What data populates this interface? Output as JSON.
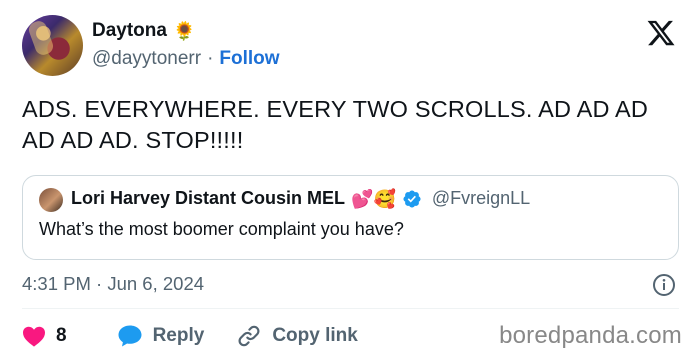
{
  "author": {
    "display_name": "Daytona",
    "name_emoji": "🌻",
    "handle": "@dayytonerr",
    "separator": "·",
    "follow_label": "Follow"
  },
  "tweet": {
    "text": "ADS. EVERYWHERE. EVERY TWO SCROLLS. AD AD AD AD AD AD. STOP!!!!!",
    "timestamp": "4:31 PM · Jun 6, 2024"
  },
  "quoted_tweet": {
    "display_name": "Lori Harvey Distant Cousin MEL",
    "name_emojis": "💕🥰",
    "handle": "@FvreignLL",
    "text": "What’s the most boomer complaint you have?"
  },
  "actions": {
    "like_count": "8",
    "reply_label": "Reply",
    "copy_link_label": "Copy link"
  },
  "watermark": "boredpanda.com",
  "icons": {
    "logo": "x-logo-icon",
    "verified": "verified-badge-icon",
    "info": "info-icon",
    "like": "heart-icon",
    "reply": "reply-bubble-icon",
    "link": "link-icon"
  },
  "colors": {
    "follow": "#1d70d6",
    "verified": "#1d9bf0",
    "heart": "#f91880",
    "muted": "#536471",
    "reply_icon": "#1d9bf0"
  }
}
